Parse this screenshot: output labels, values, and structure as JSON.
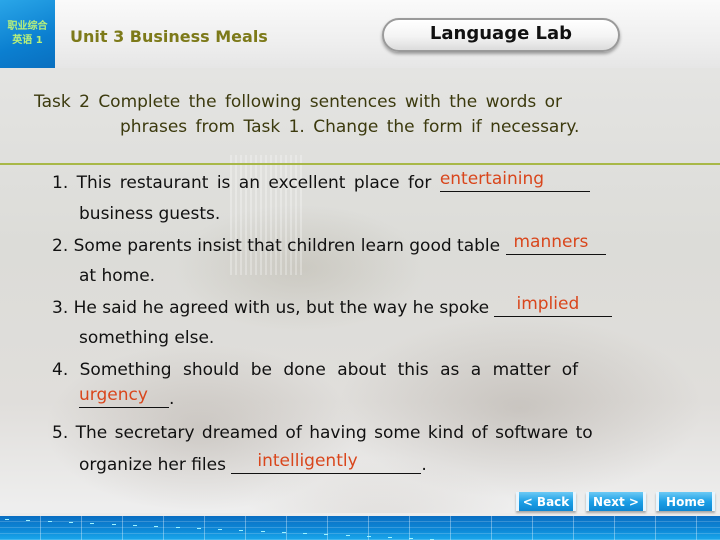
{
  "header": {
    "logo_line1": "职业综合",
    "logo_line2": "英语 1",
    "unit_title": "Unit 3 Business Meals",
    "section_badge": "Language Lab"
  },
  "task": {
    "line1": "Task 2 Complete the following sentences with the words or",
    "line2": "phrases from Task 1. Change the form if necessary."
  },
  "items": [
    {
      "number": "1.",
      "before": "This restaurant is an excellent place for",
      "answer": "entertaining",
      "after": "business guests."
    },
    {
      "number": "2.",
      "before": "Some parents insist that children learn good table",
      "answer": "manners",
      "after": "at home."
    },
    {
      "number": "3.",
      "before": "He said he agreed with us, but the way he spoke",
      "answer": "implied",
      "after": "something else."
    },
    {
      "number": "4.",
      "before": "Something should be done about this as a matter of",
      "answer": "urgency",
      "after": "."
    },
    {
      "number": "5.",
      "before": "The secretary dreamed of having some kind of software to",
      "before2": "organize her files",
      "answer": "intelligently",
      "after": "."
    }
  ],
  "nav": {
    "back": "< Back",
    "next": "Next >",
    "home": "Home"
  },
  "colors": {
    "answer": "#d9461c",
    "title": "#7d7a1a",
    "rule": "#a8b847",
    "nav_button": "#1ea0e6"
  }
}
